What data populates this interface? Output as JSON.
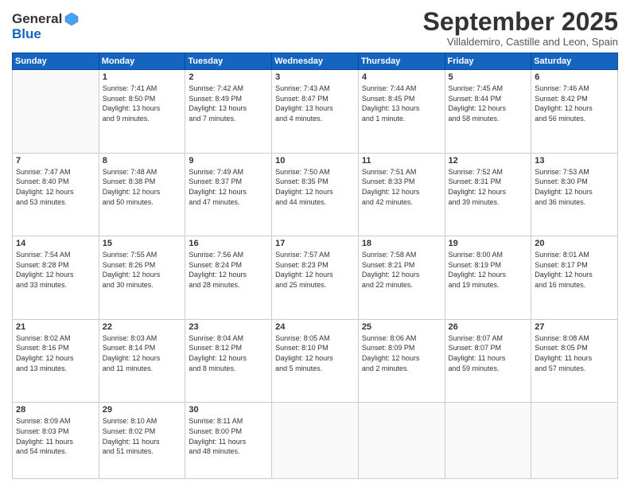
{
  "logo": {
    "general": "General",
    "blue": "Blue"
  },
  "title": "September 2025",
  "subtitle": "Villaldemiro, Castille and Leon, Spain",
  "weekdays": [
    "Sunday",
    "Monday",
    "Tuesday",
    "Wednesday",
    "Thursday",
    "Friday",
    "Saturday"
  ],
  "weeks": [
    [
      {
        "day": "",
        "info": ""
      },
      {
        "day": "1",
        "info": "Sunrise: 7:41 AM\nSunset: 8:50 PM\nDaylight: 13 hours\nand 9 minutes."
      },
      {
        "day": "2",
        "info": "Sunrise: 7:42 AM\nSunset: 8:49 PM\nDaylight: 13 hours\nand 7 minutes."
      },
      {
        "day": "3",
        "info": "Sunrise: 7:43 AM\nSunset: 8:47 PM\nDaylight: 13 hours\nand 4 minutes."
      },
      {
        "day": "4",
        "info": "Sunrise: 7:44 AM\nSunset: 8:45 PM\nDaylight: 13 hours\nand 1 minute."
      },
      {
        "day": "5",
        "info": "Sunrise: 7:45 AM\nSunset: 8:44 PM\nDaylight: 12 hours\nand 58 minutes."
      },
      {
        "day": "6",
        "info": "Sunrise: 7:46 AM\nSunset: 8:42 PM\nDaylight: 12 hours\nand 56 minutes."
      }
    ],
    [
      {
        "day": "7",
        "info": "Sunrise: 7:47 AM\nSunset: 8:40 PM\nDaylight: 12 hours\nand 53 minutes."
      },
      {
        "day": "8",
        "info": "Sunrise: 7:48 AM\nSunset: 8:38 PM\nDaylight: 12 hours\nand 50 minutes."
      },
      {
        "day": "9",
        "info": "Sunrise: 7:49 AM\nSunset: 8:37 PM\nDaylight: 12 hours\nand 47 minutes."
      },
      {
        "day": "10",
        "info": "Sunrise: 7:50 AM\nSunset: 8:35 PM\nDaylight: 12 hours\nand 44 minutes."
      },
      {
        "day": "11",
        "info": "Sunrise: 7:51 AM\nSunset: 8:33 PM\nDaylight: 12 hours\nand 42 minutes."
      },
      {
        "day": "12",
        "info": "Sunrise: 7:52 AM\nSunset: 8:31 PM\nDaylight: 12 hours\nand 39 minutes."
      },
      {
        "day": "13",
        "info": "Sunrise: 7:53 AM\nSunset: 8:30 PM\nDaylight: 12 hours\nand 36 minutes."
      }
    ],
    [
      {
        "day": "14",
        "info": "Sunrise: 7:54 AM\nSunset: 8:28 PM\nDaylight: 12 hours\nand 33 minutes."
      },
      {
        "day": "15",
        "info": "Sunrise: 7:55 AM\nSunset: 8:26 PM\nDaylight: 12 hours\nand 30 minutes."
      },
      {
        "day": "16",
        "info": "Sunrise: 7:56 AM\nSunset: 8:24 PM\nDaylight: 12 hours\nand 28 minutes."
      },
      {
        "day": "17",
        "info": "Sunrise: 7:57 AM\nSunset: 8:23 PM\nDaylight: 12 hours\nand 25 minutes."
      },
      {
        "day": "18",
        "info": "Sunrise: 7:58 AM\nSunset: 8:21 PM\nDaylight: 12 hours\nand 22 minutes."
      },
      {
        "day": "19",
        "info": "Sunrise: 8:00 AM\nSunset: 8:19 PM\nDaylight: 12 hours\nand 19 minutes."
      },
      {
        "day": "20",
        "info": "Sunrise: 8:01 AM\nSunset: 8:17 PM\nDaylight: 12 hours\nand 16 minutes."
      }
    ],
    [
      {
        "day": "21",
        "info": "Sunrise: 8:02 AM\nSunset: 8:16 PM\nDaylight: 12 hours\nand 13 minutes."
      },
      {
        "day": "22",
        "info": "Sunrise: 8:03 AM\nSunset: 8:14 PM\nDaylight: 12 hours\nand 11 minutes."
      },
      {
        "day": "23",
        "info": "Sunrise: 8:04 AM\nSunset: 8:12 PM\nDaylight: 12 hours\nand 8 minutes."
      },
      {
        "day": "24",
        "info": "Sunrise: 8:05 AM\nSunset: 8:10 PM\nDaylight: 12 hours\nand 5 minutes."
      },
      {
        "day": "25",
        "info": "Sunrise: 8:06 AM\nSunset: 8:09 PM\nDaylight: 12 hours\nand 2 minutes."
      },
      {
        "day": "26",
        "info": "Sunrise: 8:07 AM\nSunset: 8:07 PM\nDaylight: 11 hours\nand 59 minutes."
      },
      {
        "day": "27",
        "info": "Sunrise: 8:08 AM\nSunset: 8:05 PM\nDaylight: 11 hours\nand 57 minutes."
      }
    ],
    [
      {
        "day": "28",
        "info": "Sunrise: 8:09 AM\nSunset: 8:03 PM\nDaylight: 11 hours\nand 54 minutes."
      },
      {
        "day": "29",
        "info": "Sunrise: 8:10 AM\nSunset: 8:02 PM\nDaylight: 11 hours\nand 51 minutes."
      },
      {
        "day": "30",
        "info": "Sunrise: 8:11 AM\nSunset: 8:00 PM\nDaylight: 11 hours\nand 48 minutes."
      },
      {
        "day": "",
        "info": ""
      },
      {
        "day": "",
        "info": ""
      },
      {
        "day": "",
        "info": ""
      },
      {
        "day": "",
        "info": ""
      }
    ]
  ]
}
